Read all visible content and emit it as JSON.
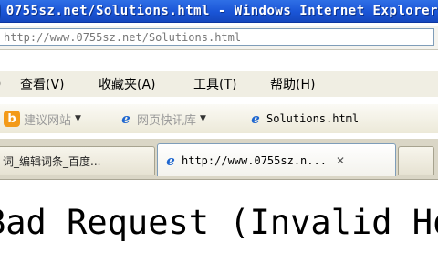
{
  "window": {
    "title": "0755sz.net/Solutions.html - Windows Internet Explorer"
  },
  "address_bar": {
    "url": "http://www.0755sz.net/Solutions.html"
  },
  "menu": {
    "items": [
      "查看(V)",
      "收藏夹(A)",
      "工具(T)",
      "帮助(H)"
    ],
    "leading_fragment": ")"
  },
  "favorites_bar": {
    "items": [
      {
        "label": "建议网站",
        "icon": "b-icon",
        "disabled": true
      },
      {
        "label": "网页快讯库",
        "icon": "ie-icon",
        "disabled": true
      },
      {
        "label": "Solutions.html",
        "icon": "ie-icon",
        "disabled": false
      }
    ]
  },
  "tabs": [
    {
      "label": "词_编辑词条_百度...",
      "active": false
    },
    {
      "label": "http://www.0755sz.n...",
      "active": true,
      "close": "✕"
    },
    {
      "label": "",
      "new_tab": true
    }
  ],
  "page": {
    "heading": "Bad Request (Invalid Hostname)"
  }
}
